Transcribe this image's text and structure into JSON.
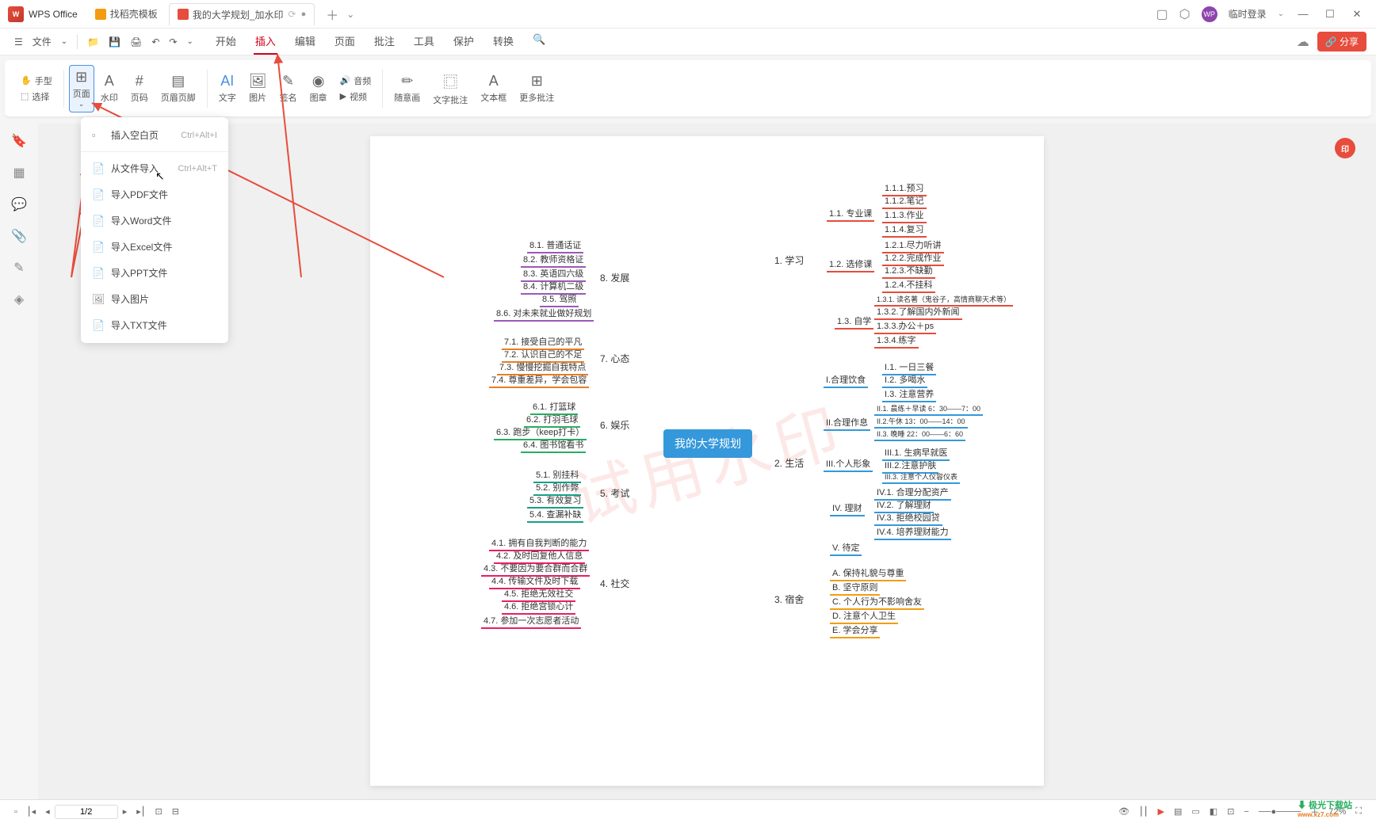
{
  "titlebar": {
    "app_name": "WPS Office",
    "tab1": "找稻壳模板",
    "tab2": "我的大学规划_加水印",
    "login": "临时登录"
  },
  "toolbar": {
    "file": "文件",
    "hand": "手型",
    "select": "选择"
  },
  "menu": {
    "start": "开始",
    "insert": "插入",
    "edit": "编辑",
    "page": "页面",
    "annotate": "批注",
    "tool": "工具",
    "protect": "保护",
    "convert": "转换"
  },
  "share": "分享",
  "ribbon": {
    "page": "页面",
    "watermark": "水印",
    "pagenum": "页码",
    "headerfooter": "页眉页脚",
    "text": "文字",
    "image": "图片",
    "sign": "签名",
    "stamp": "图章",
    "audio": "音频",
    "video": "视频",
    "freehand": "随意画",
    "textannot": "文字批注",
    "textbox": "文本框",
    "moreannot": "更多批注"
  },
  "dropdown": {
    "blank": "插入空白页",
    "blank_sc": "Ctrl+Alt+I",
    "fromfile": "从文件导入",
    "fromfile_sc": "Ctrl+Alt+T",
    "pdf": "导入PDF文件",
    "word": "导入Word文件",
    "excel": "导入Excel文件",
    "ppt": "导入PPT文件",
    "img": "导入图片",
    "txt": "导入TXT文件"
  },
  "watermark_text": "试用水印",
  "mindmap": {
    "center": "我的大学规划",
    "b1": "1. 学习",
    "b2": "2. 生活",
    "b3": "3. 宿舍",
    "b4": "4. 社交",
    "b5": "5. 考试",
    "b6": "6. 娱乐",
    "b7": "7. 心态",
    "b8": "8. 发展",
    "n1_1": "1.1. 专业课",
    "n1_2": "1.2. 选修课",
    "n1_3": "1.3. 自学",
    "n1_1_1": "1.1.1.预习",
    "n1_1_2": "1.1.2.笔记",
    "n1_1_3": "1.1.3.作业",
    "n1_1_4": "1.1.4.复习",
    "n1_2_1": "1.2.1.尽力听讲",
    "n1_2_2": "1.2.2.完成作业",
    "n1_2_3": "1.2.3.不缺勤",
    "n1_2_4": "1.2.4.不挂科",
    "n1_3_1": "1.3.1. 读名著（鬼谷子，高情商聊天术等）",
    "n1_3_2": "1.3.2.了解国内外新闻",
    "n1_3_3": "1.3.3.办公＋ps",
    "n1_3_4": "1.3.4.练字",
    "n2_1": "I.合理饮食",
    "n2_2": "II.合理作息",
    "n2_3": "III.个人形象",
    "n2_4": "IV. 理财",
    "n2_5": "V. 待定",
    "n2_1_1": "I.1. 一日三餐",
    "n2_1_2": "I.2. 多喝水",
    "n2_1_3": "I.3. 注意营养",
    "n2_2_1": "II.1. 晨练＋早读 6：30——7：00",
    "n2_2_2": "II.2.午休 13：00——14：00",
    "n2_2_3": "II.3. 晚睡 22：00——6：60",
    "n2_3_1": "III.1. 生病早就医",
    "n2_3_2": "III.2.注意护肤",
    "n2_3_3": "III.3. 注意个人仪容仪表",
    "n2_4_1": "IV.1. 合理分配资产",
    "n2_4_2": "IV.2. 了解理财",
    "n2_4_3": "IV.3. 拒绝校园贷",
    "n2_4_4": "IV.4. 培养理财能力",
    "n3_1": "A. 保持礼貌与尊重",
    "n3_2": "B. 坚守原则",
    "n3_3": "C. 个人行为不影响舍友",
    "n3_4": "D. 注意个人卫生",
    "n3_5": "E. 学会分享",
    "n4_1": "4.1. 拥有自我判断的能力",
    "n4_2": "4.2. 及时回复他人信息",
    "n4_3": "4.3. 不要因为要合群而合群",
    "n4_4": "4.4. 传输文件及时下载",
    "n4_5": "4.5. 拒绝无效社交",
    "n4_6": "4.6. 拒绝宫锁心计",
    "n4_7": "4.7. 参加一次志愿者活动",
    "n5_1": "5.1. 别挂科",
    "n5_2": "5.2. 别作弊",
    "n5_3": "5.3. 有效复习",
    "n5_4": "5.4. 查漏补缺",
    "n6_1": "6.1. 打篮球",
    "n6_2": "6.2. 打羽毛球",
    "n6_3": "6.3. 跑步（keep打卡）",
    "n6_4": "6.4. 图书馆看书",
    "n7_1": "7.1. 接受自己的平凡",
    "n7_2": "7.2. 认识自己的不足",
    "n7_3": "7.3. 慢慢挖掘自我特点",
    "n7_4": "7.4. 尊重差异，学会包容",
    "n8_1": "8.1. 普通话证",
    "n8_2": "8.2. 教师资格证",
    "n8_3": "8.3. 英语四六级",
    "n8_4": "8.4. 计算机二级",
    "n8_5": "8.5. 驾照",
    "n8_6": "8.6. 对未来就业做好规划"
  },
  "statusbar": {
    "page": "1/2",
    "zoom": "72%"
  },
  "footer": {
    "name": "极光下载站",
    "url": "www.xz7.com"
  },
  "pdf_badge": "印"
}
